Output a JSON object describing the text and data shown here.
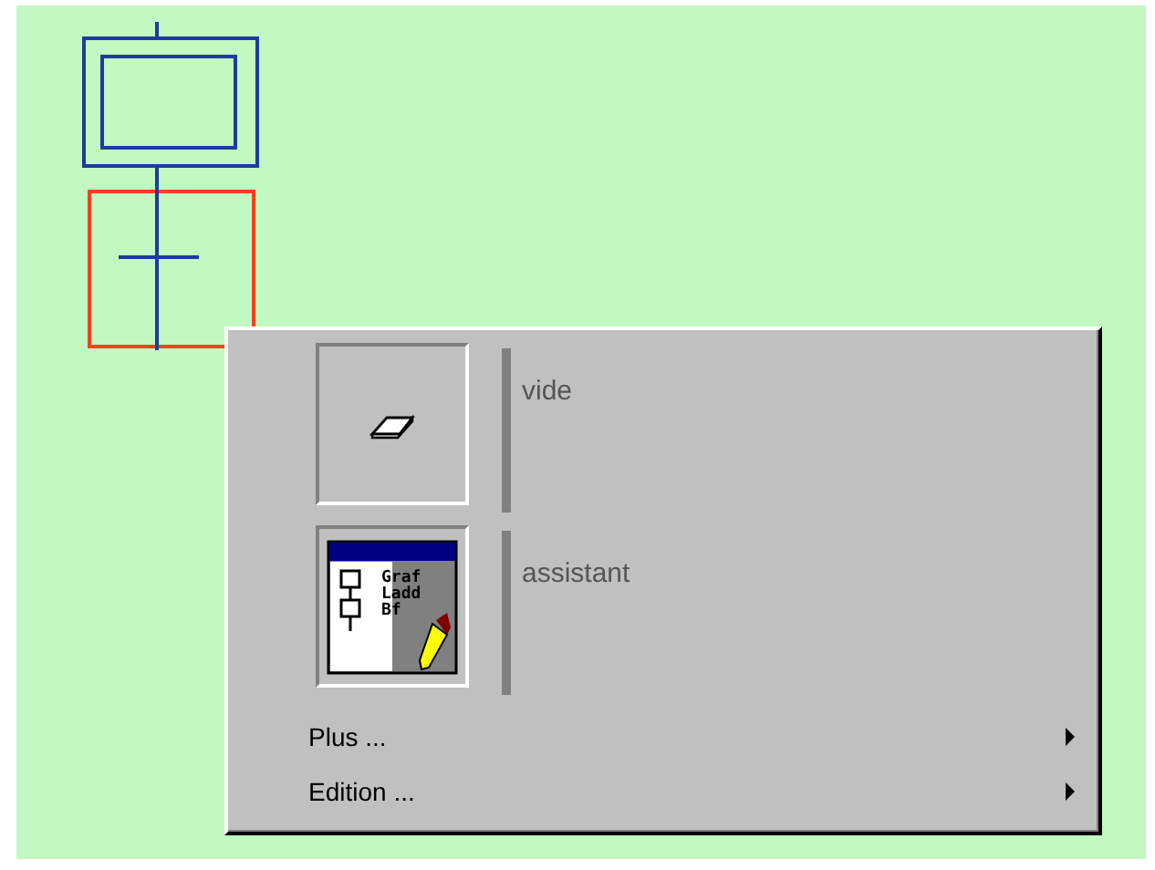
{
  "menu": {
    "tiles": [
      {
        "kind": "eraser",
        "label": "vide"
      },
      {
        "kind": "wizard",
        "label": "assistant",
        "icon_text": [
          "Graf",
          "Ladd",
          "Bf"
        ]
      }
    ],
    "items": [
      {
        "label": "Plus ...",
        "submenu": true
      },
      {
        "label": "Edition ...",
        "submenu": true
      }
    ]
  }
}
